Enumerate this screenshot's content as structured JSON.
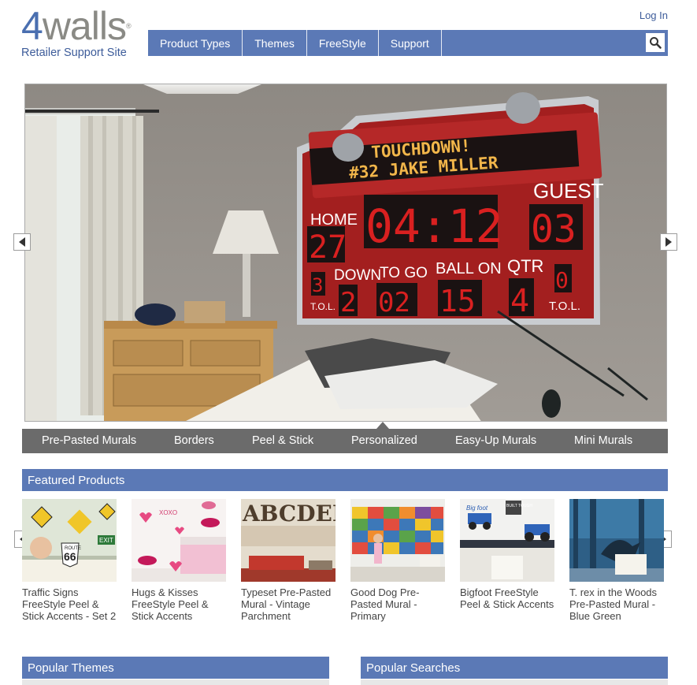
{
  "logo": {
    "brand_number": "4",
    "brand_word": "walls",
    "registered": "®",
    "subtitle": "Retailer Support Site"
  },
  "header": {
    "login_label": "Log In"
  },
  "nav": {
    "items": [
      {
        "label": "Product Types"
      },
      {
        "label": "Themes"
      },
      {
        "label": "FreeStyle"
      },
      {
        "label": "Support"
      }
    ]
  },
  "hero": {
    "scoreboard": {
      "line1": "TOUCHDOWN!",
      "line2": "#32 JAKE MILLER",
      "home_label": "HOME",
      "guest_label": "GUEST",
      "home_score": "27",
      "guest_score": "03",
      "clock": "04:12",
      "down_label": "DOWN",
      "togo_label": "TO GO",
      "ballon_label": "BALL ON",
      "qtr_label": "QTR",
      "down": "2",
      "togo": "02",
      "ballon": "15",
      "qtr": "4",
      "tol_left_value": "3",
      "tol_right_value": "0",
      "tol_label": "T.O.L."
    }
  },
  "categories": {
    "items": [
      {
        "label": "Pre-Pasted Murals"
      },
      {
        "label": "Borders"
      },
      {
        "label": "Peel & Stick"
      },
      {
        "label": "Personalized"
      },
      {
        "label": "Easy-Up Murals"
      },
      {
        "label": "Mini Murals"
      }
    ],
    "active_index": 3
  },
  "featured": {
    "title": "Featured Products",
    "products": [
      {
        "name": "Traffic Signs FreeStyle Peel & Stick Accents - Set 2"
      },
      {
        "name": "Hugs & Kisses FreeStyle Peel & Stick Accents"
      },
      {
        "name": "Typeset Pre-Pasted Mural - Vintage Parchment"
      },
      {
        "name": "Good Dog Pre-Pasted Mural - Primary"
      },
      {
        "name": "Bigfoot FreeStyle Peel & Stick Accents"
      },
      {
        "name": "T. rex in the Woods Pre-Pasted Mural - Blue Green"
      }
    ],
    "thumb_text": {
      "route": "ROUTE",
      "route_number": "66",
      "exit": "EXIT",
      "xoxo": "XOXO",
      "typeset_letters": "ABCDEFGHIJKLMNOPQRSTUVWXYZ",
      "bigfoot": "Big foot",
      "built_tough": "BUILT TOUGH"
    }
  },
  "popular_themes": {
    "title": "Popular Themes"
  },
  "popular_searches": {
    "title": "Popular Searches"
  },
  "colors": {
    "brand_blue": "#5b79b6",
    "logo_gray": "#8a8a85",
    "category_bar": "#6b6b6b",
    "scoreboard_red": "#a31f1f"
  },
  "icons": [
    "search-icon",
    "arrow-left-icon",
    "arrow-right-icon"
  ]
}
